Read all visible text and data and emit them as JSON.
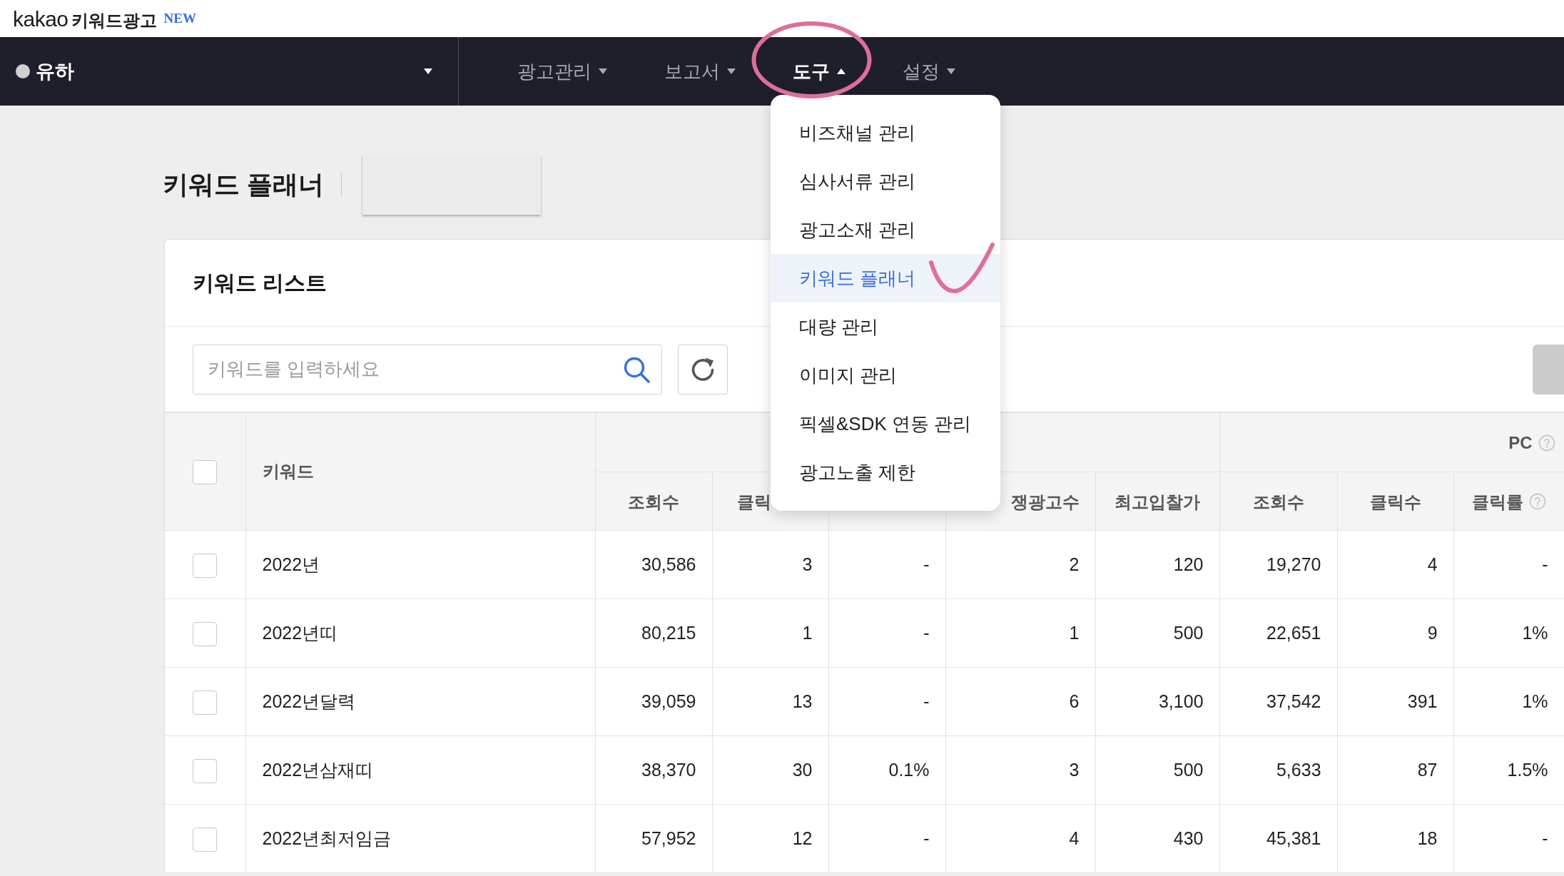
{
  "logo": {
    "brand": "kakao",
    "product": "키워드광고",
    "badge": "NEW"
  },
  "nav": {
    "account": {
      "name": "유하"
    },
    "menus": [
      {
        "label": "광고관리",
        "expanded": false,
        "circled": false
      },
      {
        "label": "보고서",
        "expanded": false,
        "circled": false
      },
      {
        "label": "도구",
        "expanded": true,
        "circled": true,
        "items": [
          {
            "label": "비즈채널 관리",
            "selected": false,
            "ticked": false
          },
          {
            "label": "심사서류 관리",
            "selected": false,
            "ticked": false
          },
          {
            "label": "광고소재 관리",
            "selected": false,
            "ticked": false
          },
          {
            "label": "키워드 플래너",
            "selected": true,
            "ticked": true
          },
          {
            "label": "대량 관리",
            "selected": false,
            "ticked": false
          },
          {
            "label": "이미지 관리",
            "selected": false,
            "ticked": false
          },
          {
            "label": "픽셀&SDK 연동 관리",
            "selected": false,
            "ticked": false
          },
          {
            "label": "광고노출 제한",
            "selected": false,
            "ticked": false
          }
        ]
      },
      {
        "label": "설정",
        "expanded": false,
        "circled": false
      }
    ]
  },
  "page": {
    "title": "키워드 플래너"
  },
  "keyword_list": {
    "title": "키워드 리스트",
    "search": {
      "placeholder": "키워드를 입력하세요"
    },
    "table": {
      "select_all": {
        "checked": false
      },
      "key_column": {
        "label": "키워드"
      },
      "column_groups": [
        {
          "help": false,
          "columns": [
            {
              "label": "조회수",
              "help": false
            },
            {
              "label": "클릭",
              "help": false
            },
            {
              "help": false
            },
            {
              "label": "쟁광고수",
              "help": false
            },
            {
              "label": "최고입찰가",
              "help": false
            }
          ]
        },
        {
          "label": "PC",
          "help": true,
          "columns": [
            {
              "label": "조회수",
              "help": false
            },
            {
              "label": "클릭수",
              "help": false
            },
            {
              "label": "클릭률",
              "help": true
            }
          ]
        }
      ],
      "rows": [
        {
          "checked": false,
          "cells": [
            "2022년",
            "30,586",
            "3",
            "-",
            "2",
            "120",
            "19,270",
            "4",
            "-"
          ]
        },
        {
          "checked": false,
          "cells": [
            "2022년띠",
            "80,215",
            "1",
            "-",
            "1",
            "500",
            "22,651",
            "9",
            "1%"
          ]
        },
        {
          "checked": false,
          "cells": [
            "2022년달력",
            "39,059",
            "13",
            "-",
            "6",
            "3,100",
            "37,542",
            "391",
            "1%"
          ]
        },
        {
          "checked": false,
          "cells": [
            "2022년삼재띠",
            "38,370",
            "30",
            "0.1%",
            "3",
            "500",
            "5,633",
            "87",
            "1.5%"
          ]
        },
        {
          "checked": false,
          "cells": [
            "2022년최저임금",
            "57,952",
            "12",
            "-",
            "4",
            "430",
            "45,381",
            "18",
            "-"
          ]
        }
      ]
    }
  }
}
